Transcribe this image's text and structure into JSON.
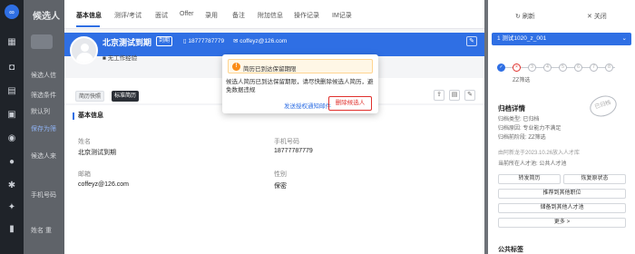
{
  "app": {
    "logo_glyph": "∞"
  },
  "background": {
    "title": "候选人",
    "lines": [
      "候选人信",
      "筛选条件",
      "默认列",
      "保存为筛",
      "候选人来",
      "手机号码",
      "姓名 重"
    ]
  },
  "tabs": [
    {
      "label": "基本信息",
      "active": true
    },
    {
      "label": "测评/考试"
    },
    {
      "label": "面试"
    },
    {
      "label": "Offer"
    },
    {
      "label": "录用"
    },
    {
      "label": "备注"
    },
    {
      "label": "附加信息"
    },
    {
      "label": "操作记录"
    },
    {
      "label": "IM记录"
    }
  ],
  "candidate": {
    "name": "北京测试到期",
    "status": "到期",
    "phone": "18777787779",
    "email": "coffeyz@126.com",
    "experience": "无工作经验"
  },
  "actions": {
    "resume_original": "简历快照",
    "resume_standard": "标准简历"
  },
  "section": {
    "title": "基本信息"
  },
  "fields": [
    {
      "label": "姓名",
      "value": "北京测试到期"
    },
    {
      "label": "手机号码",
      "value": "18777787779"
    },
    {
      "label": "邮箱",
      "value": "coffeyz@126.com"
    },
    {
      "label": "性别",
      "value": "保密"
    }
  ],
  "popover": {
    "warning": "简历已到达保留期限",
    "message": "候选人简历已到达保留期限，请尽快删除候选人简历，避免数据违规",
    "link": "发送授权通知邮件",
    "delete": "删除候选人"
  },
  "right": {
    "refresh": "刷新",
    "close": "关闭",
    "job": "1 测试1020_z_001",
    "steps": [
      "✓",
      "×",
      "3",
      "4",
      "5",
      "6",
      "7",
      "8"
    ],
    "stage_name": "ZZ筛选",
    "archive_title": "归档详情",
    "archive_lines": [
      "归档类型: 已归档",
      "归档原因: 专业能力不满足",
      "归档前阶段: ZZ筛选",
      "由阿新龙于2023.10.26放入人才库",
      "当前所在人才池: 公共人才池"
    ],
    "stamp": "已归档",
    "buttons": [
      "转发简历",
      "恢复原状态",
      "推荐到其他职位",
      "储备到其他人才池",
      "更多 >"
    ],
    "public_tags": "公共标签"
  }
}
